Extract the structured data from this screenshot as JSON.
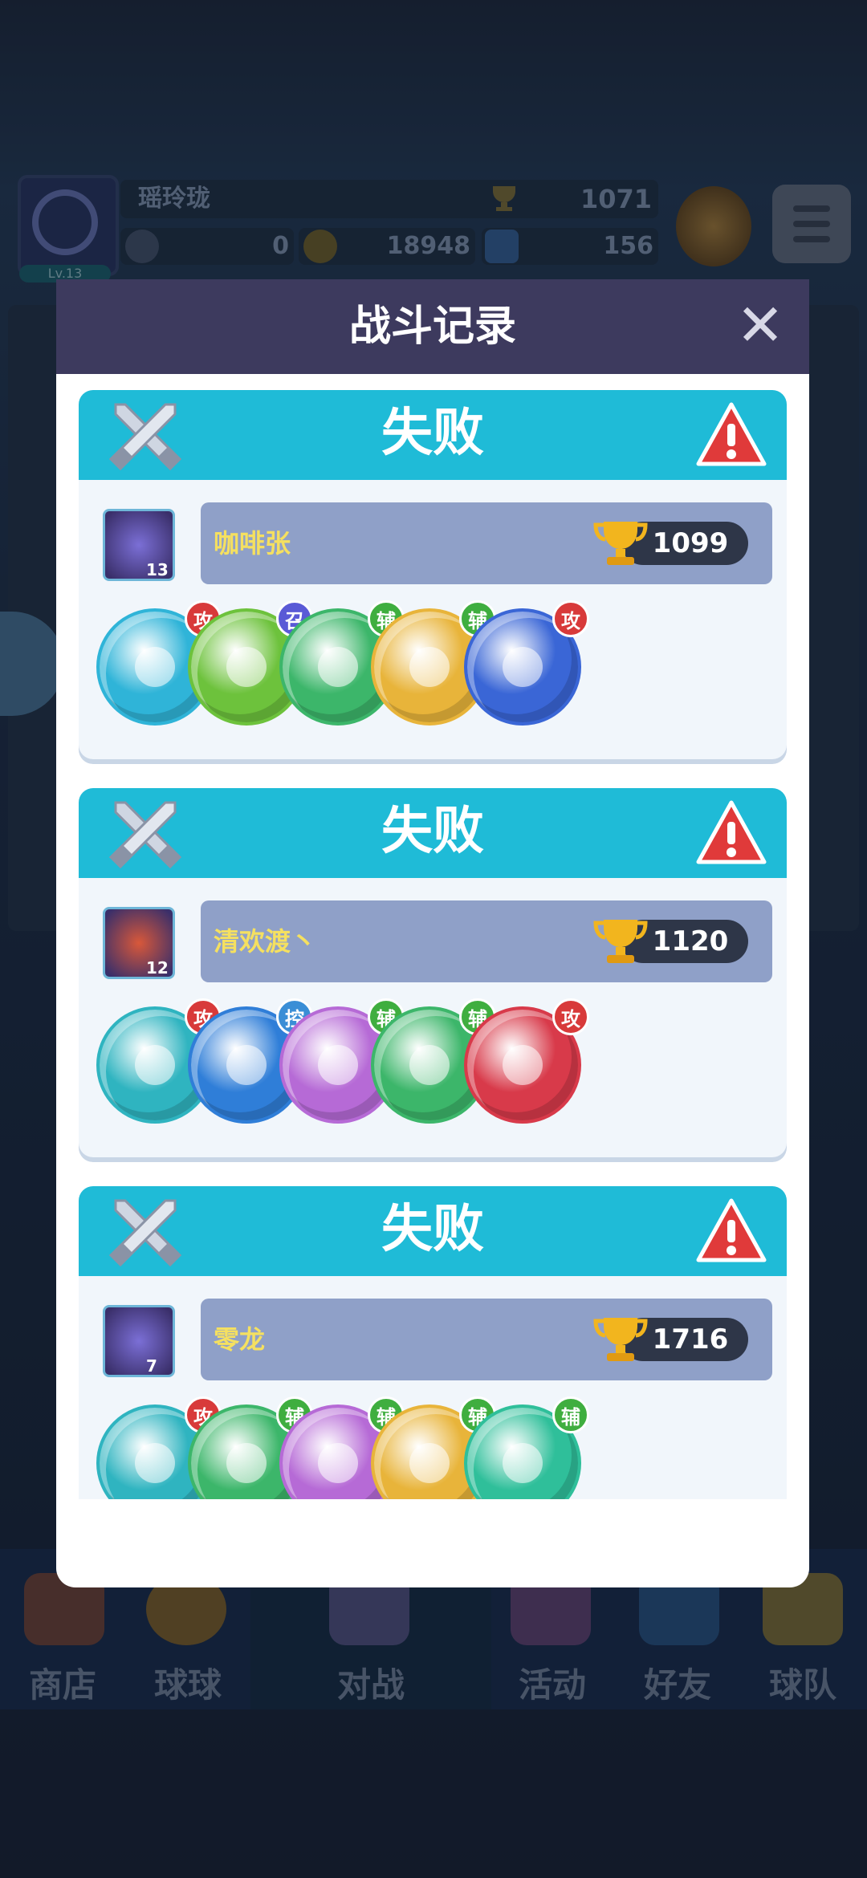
{
  "background": {
    "player_name": "瑶玲珑",
    "level": "Lv.13",
    "trophies": "1071",
    "currency_a": "0",
    "currency_b": "18948",
    "currency_c": "156"
  },
  "bottom_nav": [
    "商店",
    "球球",
    "对战",
    "活动",
    "好友",
    "球队"
  ],
  "dialog": {
    "title": "战斗记录",
    "close_icon": "close-icon"
  },
  "records": [
    {
      "result": "失败",
      "player": {
        "name": "咖啡张",
        "level": "13",
        "trophies": "1099",
        "avatar_color": "#7b6fd6"
      },
      "balls": [
        {
          "tag": "攻",
          "tag_color": "#d83a3a",
          "color": "#2fb4d8"
        },
        {
          "tag": "召",
          "tag_color": "#5a5ad6",
          "color": "#6dc23c"
        },
        {
          "tag": "辅",
          "tag_color": "#3fae3f",
          "color": "#3cb66a"
        },
        {
          "tag": "辅",
          "tag_color": "#3fae3f",
          "color": "#e8b43a"
        },
        {
          "tag": "攻",
          "tag_color": "#d83a3a",
          "color": "#3a66d6"
        }
      ]
    },
    {
      "result": "失败",
      "player": {
        "name": "清欢渡丶",
        "level": "12",
        "trophies": "1120",
        "avatar_color": "#d8583a"
      },
      "balls": [
        {
          "tag": "攻",
          "tag_color": "#d83a3a",
          "color": "#2fb4c0"
        },
        {
          "tag": "控",
          "tag_color": "#3a8ed6",
          "color": "#2f7ed8"
        },
        {
          "tag": "辅",
          "tag_color": "#3fae3f",
          "color": "#b66ad6"
        },
        {
          "tag": "辅",
          "tag_color": "#3fae3f",
          "color": "#3cb66a"
        },
        {
          "tag": "攻",
          "tag_color": "#d83a3a",
          "color": "#d83a4a"
        }
      ]
    },
    {
      "result": "失败",
      "player": {
        "name": "零龙",
        "level": "7",
        "trophies": "1716",
        "avatar_color": "#7b6fd6"
      },
      "balls": [
        {
          "tag": "攻",
          "tag_color": "#d83a3a",
          "color": "#2fb4c0"
        },
        {
          "tag": "辅",
          "tag_color": "#3fae3f",
          "color": "#3cb66a"
        },
        {
          "tag": "辅",
          "tag_color": "#3fae3f",
          "color": "#b66ad6"
        },
        {
          "tag": "辅",
          "tag_color": "#3fae3f",
          "color": "#e8b43a"
        },
        {
          "tag": "辅",
          "tag_color": "#3fae3f",
          "color": "#2fbf9a"
        }
      ]
    }
  ]
}
